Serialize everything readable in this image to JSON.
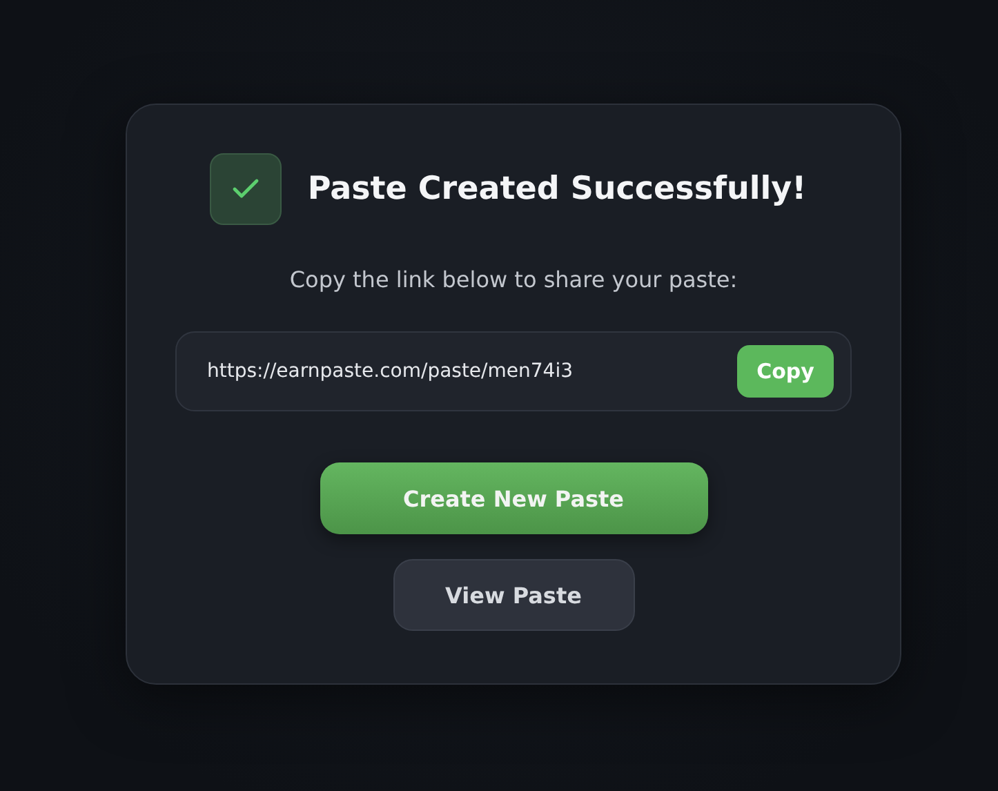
{
  "title": "Paste Created Successfully!",
  "subtitle": "Copy the link below to share your paste:",
  "link": {
    "value": "https://earnpaste.com/paste/men74i3",
    "button": "Copy"
  },
  "actions": [
    {
      "label": "Create New Paste",
      "kind": "primary"
    },
    {
      "label": "View Paste",
      "kind": "secondary"
    }
  ]
}
